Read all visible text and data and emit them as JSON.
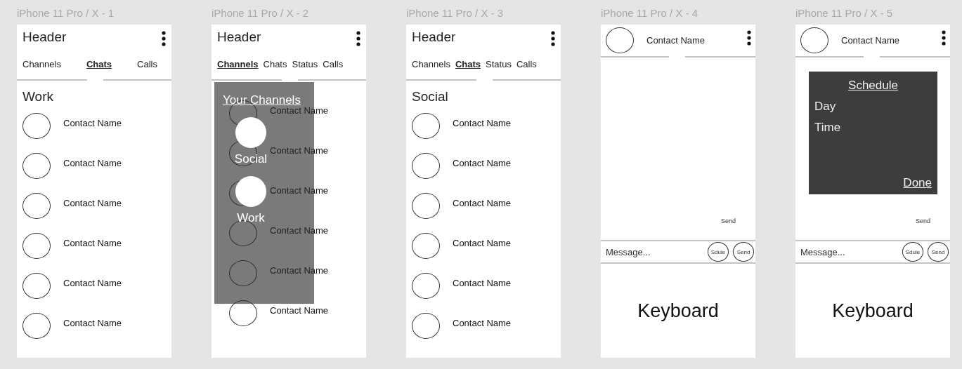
{
  "frames": [
    {
      "label": "iPhone 11 Pro / X - 1",
      "kind": "list",
      "header": "Header",
      "tabs": [
        {
          "label": "Channels",
          "selected": false
        },
        {
          "label": "Chats",
          "selected": true
        },
        {
          "label": "Calls",
          "selected": false
        }
      ],
      "section": "Work",
      "contacts": [
        "Contact Name",
        "Contact Name",
        "Contact Name",
        "Contact Name",
        "Contact Name",
        "Contact Name"
      ]
    },
    {
      "label": "iPhone 11 Pro / X - 2",
      "kind": "list",
      "header": "Header",
      "tabs": [
        {
          "label": "Channels",
          "selected": true
        },
        {
          "label": "Chats",
          "selected": false
        },
        {
          "label": "Status",
          "selected": false
        },
        {
          "label": "Calls",
          "selected": false
        }
      ],
      "contacts": [
        "Contact Name",
        "Contact Name",
        "Contact Name",
        "Contact Name",
        "Contact Name",
        "Contact Name"
      ],
      "channel_menu": {
        "title": "Your Channels",
        "channels": [
          "Social",
          "Work"
        ]
      }
    },
    {
      "label": "iPhone 11 Pro / X - 3",
      "kind": "list",
      "header": "Header",
      "tabs": [
        {
          "label": "Channels",
          "selected": false
        },
        {
          "label": "Chats",
          "selected": true
        },
        {
          "label": "Status",
          "selected": false
        },
        {
          "label": "Calls",
          "selected": false
        }
      ],
      "section": "Social",
      "contacts": [
        "Contact Name",
        "Contact Name",
        "Contact Name",
        "Contact Name",
        "Contact Name",
        "Contact Name"
      ]
    },
    {
      "label": "iPhone 11 Pro / X - 4",
      "kind": "chat",
      "contact": "Contact Name",
      "message": "Send",
      "placeholder": "Message...",
      "actions": [
        "Sdule",
        "Send"
      ],
      "keyboard": "Keyboard"
    },
    {
      "label": "iPhone 11 Pro / X - 5",
      "kind": "chat",
      "contact": "Contact Name",
      "schedule_dialog": {
        "title": "Schedule",
        "fields": [
          "Day",
          "Time"
        ],
        "done": "Done"
      },
      "message": "Send",
      "placeholder": "Message...",
      "actions": [
        "Sdule",
        "Send"
      ],
      "keyboard": "Keyboard"
    }
  ]
}
